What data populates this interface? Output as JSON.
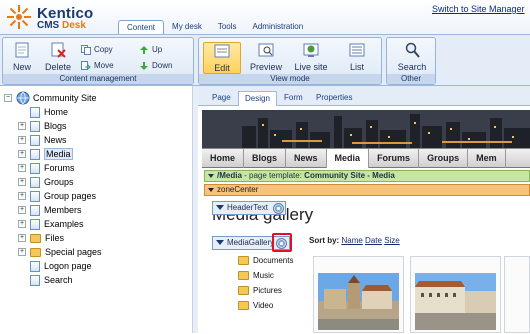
{
  "app": {
    "logo_name": "Kentico",
    "logo_product": "CMS",
    "logo_desk": "Desk",
    "switch_link": "Switch to Site Manager"
  },
  "top_tabs": [
    {
      "label": "Content",
      "active": true
    },
    {
      "label": "My desk"
    },
    {
      "label": "Tools"
    },
    {
      "label": "Administration"
    }
  ],
  "ribbon": {
    "content_management": {
      "label": "Content management",
      "new": "New",
      "delete": "Delete",
      "copy": "Copy",
      "move": "Move",
      "up": "Up",
      "down": "Down"
    },
    "view_mode": {
      "label": "View mode",
      "edit": "Edit",
      "preview": "Preview",
      "live_site": "Live site",
      "list": "List"
    },
    "other": {
      "label": "Other",
      "search": "Search"
    }
  },
  "tree": {
    "root": "Community Site",
    "items": [
      {
        "label": "Home",
        "type": "page",
        "expandable": false
      },
      {
        "label": "Blogs",
        "type": "page",
        "expandable": true
      },
      {
        "label": "News",
        "type": "page",
        "expandable": true
      },
      {
        "label": "Media",
        "type": "page",
        "expandable": true,
        "selected": true
      },
      {
        "label": "Forums",
        "type": "page",
        "expandable": true
      },
      {
        "label": "Groups",
        "type": "page",
        "expandable": true
      },
      {
        "label": "Group pages",
        "type": "page",
        "expandable": true
      },
      {
        "label": "Members",
        "type": "page",
        "expandable": true
      },
      {
        "label": "Examples",
        "type": "page",
        "expandable": true
      },
      {
        "label": "Files",
        "type": "folder",
        "expandable": true
      },
      {
        "label": "Special pages",
        "type": "folder",
        "expandable": true
      },
      {
        "label": "Logon page",
        "type": "page",
        "expandable": false
      },
      {
        "label": "Search",
        "type": "page",
        "expandable": false
      }
    ]
  },
  "sub_tabs": [
    {
      "label": "Page"
    },
    {
      "label": "Design",
      "active": true
    },
    {
      "label": "Form"
    },
    {
      "label": "Properties"
    }
  ],
  "site_nav": [
    {
      "label": "Home"
    },
    {
      "label": "Blogs"
    },
    {
      "label": "News"
    },
    {
      "label": "Media",
      "selected": true
    },
    {
      "label": "Forums"
    },
    {
      "label": "Groups"
    },
    {
      "label": "Mem"
    }
  ],
  "design": {
    "template_prefix": "/Media",
    "template_middle": " - page template: ",
    "template_name": "Community Site - Media",
    "zone": "zoneCenter",
    "header_webpart": "HeaderText",
    "header_text": "Media gallery",
    "media_webpart": "MediaGallery",
    "sort_by_label": "Sort by:",
    "sort_options": [
      "Name",
      "Date",
      "Size"
    ],
    "folders": [
      "Documents",
      "Music",
      "Pictures",
      "Video"
    ]
  },
  "colors": {
    "accent": "#e8790c",
    "selection_red": "#e3101d",
    "template_bar": "#c7e6a3",
    "zone_bar": "#f6c27c"
  }
}
